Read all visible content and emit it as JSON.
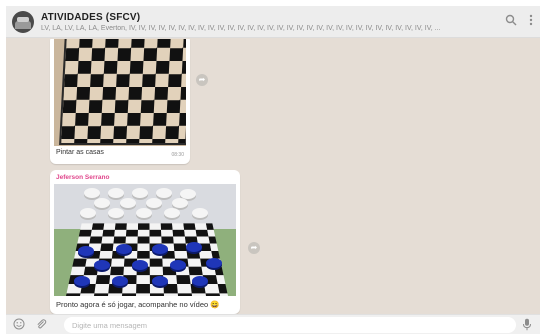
{
  "header": {
    "title": "ATIVIDADES (SFCV)",
    "participants": "LV, LA, LV, LA, LA, Everton, IV, IV, IV, IV, IV, IV, IV, IV, IV, IV, IV, IV, IV, IV, IV, IV, IV, IV, IV, IV, IV, IV, IV, IV, IV, IV, IV, IV, IV, IV, IV, ...",
    "search_icon": "search-icon",
    "menu_icon": "kebab-menu-icon"
  },
  "messages": [
    {
      "caption": "Pintar as casas",
      "time": "08:30"
    },
    {
      "sender": "Jeferson Serrano",
      "caption": "Pronto agora é só jogar, acompanhe no vídeo 😄"
    }
  ],
  "composer": {
    "placeholder": "Digite uma mensagem",
    "emoji_icon": "emoji-icon",
    "attach_icon": "paperclip-icon",
    "mic_icon": "microphone-icon"
  },
  "colors": {
    "chat_background": "#e5ddd5",
    "header_background": "#ededed",
    "sender_name": "#e0468c",
    "checker_blue": "#1f36b8"
  }
}
